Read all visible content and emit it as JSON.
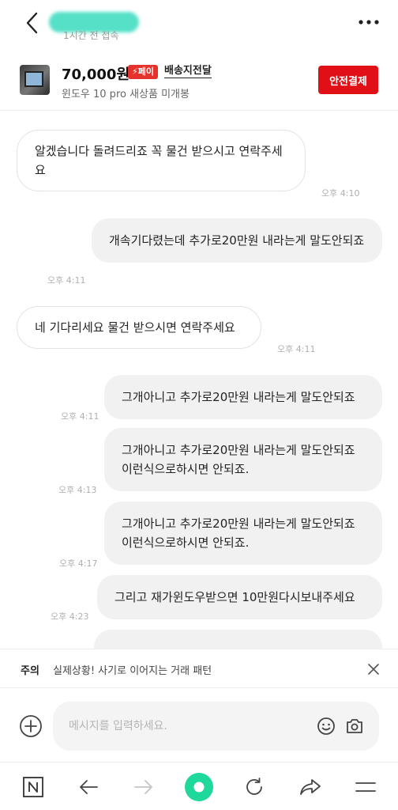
{
  "header": {
    "last_seen": "1시간 전 접속"
  },
  "product": {
    "price": "70,000원",
    "pay_badge": "⚡페이",
    "delivery": "배송지전달",
    "subtitle": "윈도우 10 pro 새상품 미개봉",
    "safe_pay_label": "안전결제"
  },
  "messages": [
    {
      "direction": "in",
      "text": "알겠습니다 돌려드리죠 꼭 물건 받으시고 연락주세요",
      "time": "오후 4:10"
    },
    {
      "direction": "out",
      "text": "개속기다렸는데 추가로20만원 내라는게 말도안되죠",
      "time": "오후 4:11"
    },
    {
      "direction": "in",
      "text": "네 기다리세요 물건 받으시면 연락주세요",
      "time": "오후 4:11"
    },
    {
      "direction": "out",
      "text": "그개아니고 추가로20만원 내라는게 말도안되죠",
      "time": "오후 4:11"
    },
    {
      "direction": "out",
      "text": "그개아니고 추가로20만원 내라는게 말도안되죠 이런식으로하시면 안되죠.",
      "time": "오후 4:13"
    },
    {
      "direction": "out",
      "text": "그개아니고 추가로20만원 내라는게 말도안되죠 이런식으로하시면 안되죠.",
      "time": "오후 4:17"
    },
    {
      "direction": "out",
      "text": "그리고 재가윈도우받으면 10만원다시보내주세요",
      "time": "오후 4:23"
    }
  ],
  "warning": {
    "label": "주의",
    "text": "실제상황! 사기로 이어지는 거래 패턴"
  },
  "composer": {
    "placeholder": "메시지를 입력하세요."
  },
  "icons": {
    "back": "chevron-left-icon",
    "more": "more-horizontal-icon",
    "close": "close-icon",
    "plus": "plus-circle-icon",
    "emoji": "emoji-icon",
    "camera": "camera-icon",
    "home": "naver-n-icon",
    "nav_back": "arrow-left-icon",
    "nav_forward": "arrow-right-icon",
    "green_dot": "green-dot-icon",
    "refresh": "refresh-icon",
    "share": "share-icon",
    "menu": "menu-icon"
  },
  "colors": {
    "accent_red": "#e10f16",
    "pay_badge": "#e6322d",
    "green_dot": "#1ed99b"
  }
}
